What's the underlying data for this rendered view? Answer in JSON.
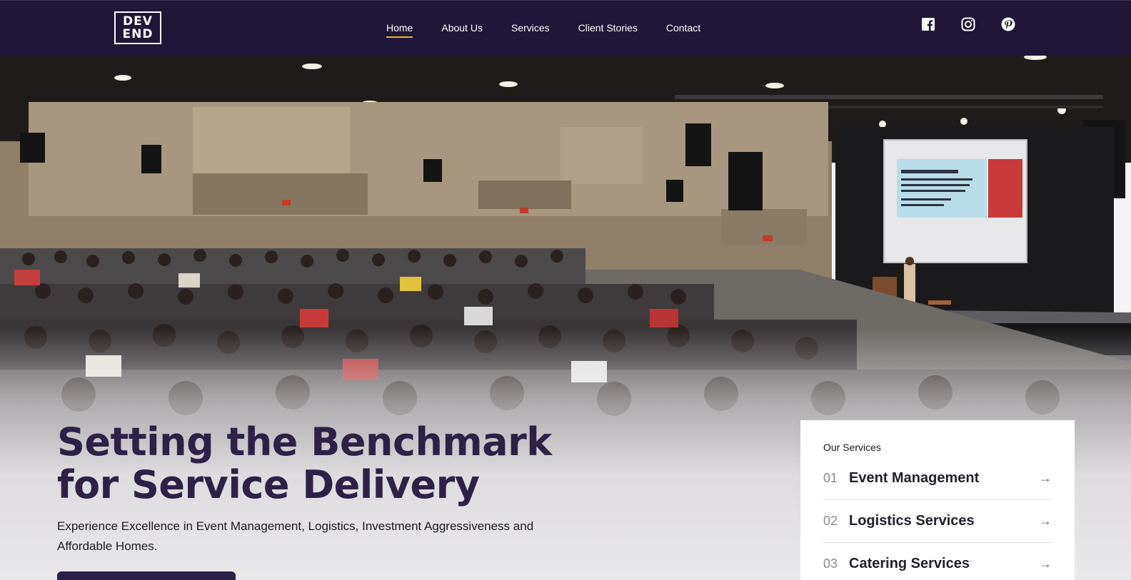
{
  "brand": {
    "logo_line1": "DEV",
    "logo_line2": "END"
  },
  "nav": {
    "items": [
      {
        "label": "Home",
        "active": true
      },
      {
        "label": "About Us"
      },
      {
        "label": "Services"
      },
      {
        "label": "Client Stories"
      },
      {
        "label": "Contact"
      }
    ]
  },
  "socials": [
    "facebook-icon",
    "instagram-icon",
    "pinterest-icon"
  ],
  "hero": {
    "title": "Setting the Benchmark for Service Delivery",
    "subtitle": "Experience Excellence in Event Management, Logistics, Investment Aggressiveness and Affordable Homes."
  },
  "services": {
    "title": "Our Services",
    "items": [
      {
        "num": "01",
        "name": "Event Management",
        "arrow": "→"
      },
      {
        "num": "02",
        "name": "Logistics Services",
        "arrow": "→"
      },
      {
        "num": "03",
        "name": "Catering Services",
        "arrow": "→"
      }
    ]
  },
  "colors": {
    "header_bg": "#1f1638",
    "accent": "#e8b923",
    "headline": "#2d2146"
  }
}
